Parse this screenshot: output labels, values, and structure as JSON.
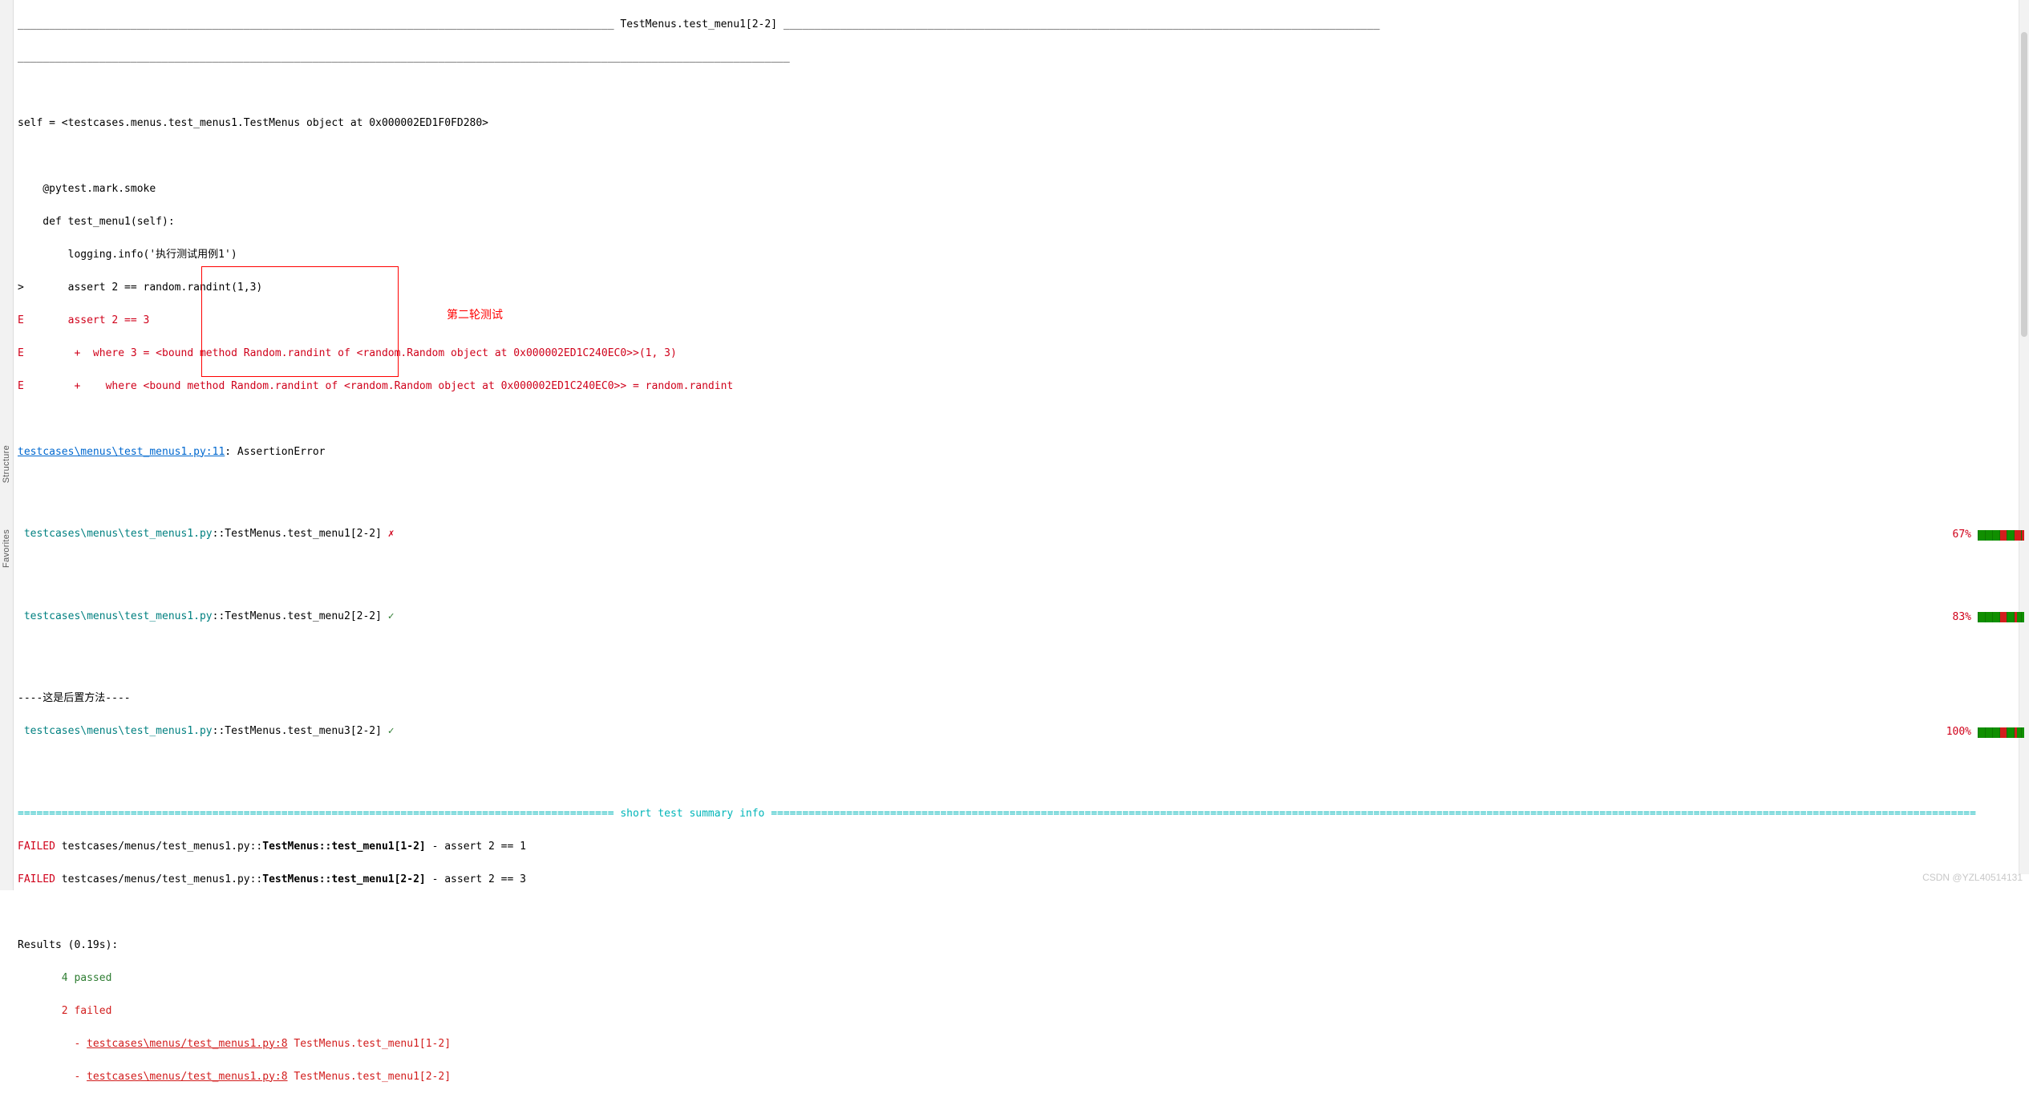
{
  "sidebar": {
    "structure": "Structure",
    "favorites": "Favorites"
  },
  "header": {
    "rule_left": "_______________________________________________________________________________________________",
    "test_label": " TestMenus.test_menu1[2-2] ",
    "rule_right": "_______________________________________________________________________________________________",
    "rule_under": "___________________________________________________________________________________________________________________________"
  },
  "self_line": "self = <testcases.menus.test_menus1.TestMenus object at 0x000002ED1F0FD280>",
  "code": {
    "decorator": "    @pytest.mark.smoke",
    "def": "    def test_menu1(self):",
    "log": "        logging.info('执行测试用例1')",
    "assert": ">       assert 2 == random.randint(1,3)",
    "e1": "E       assert 2 == 3",
    "e2": "E        +  where 3 = <bound method Random.randint of <random.Random object at 0x000002ED1C240EC0>>(1, 3)",
    "e3": "E        +    where <bound method Random.randint of <random.Random object at 0x000002ED1C240EC0>> = random.randint"
  },
  "file_err": {
    "link": "testcases\\menus\\test_menus1.py:11",
    "suffix": ": AssertionError"
  },
  "rows": [
    {
      "path": " testcases\\menus\\test_menus1.py",
      "test": "::TestMenus.test_menu1[2-2] ",
      "mark": "✗",
      "pass": false,
      "pct": "67%",
      "bar": [
        [
          "g",
          0,
          9
        ],
        [
          "g",
          9,
          18
        ],
        [
          "g",
          18,
          27
        ],
        [
          "r",
          27,
          36
        ],
        [
          "g",
          36,
          45
        ],
        [
          "r",
          45,
          58
        ]
      ]
    },
    {
      "path": " testcases\\menus\\test_menus1.py",
      "test": "::TestMenus.test_menu2[2-2] ",
      "mark": "✓",
      "pass": true,
      "pct": "83%",
      "bar": [
        [
          "g",
          0,
          9
        ],
        [
          "g",
          9,
          18
        ],
        [
          "g",
          18,
          27
        ],
        [
          "r",
          27,
          36
        ],
        [
          "g",
          36,
          45
        ],
        [
          "r",
          45,
          49
        ],
        [
          "g",
          49,
          58
        ]
      ]
    },
    {
      "path": " testcases\\menus\\test_menus1.py",
      "test": "::TestMenus.test_menu3[2-2] ",
      "mark": "✓",
      "pass": true,
      "pct": "100%",
      "bar": [
        [
          "g",
          0,
          9
        ],
        [
          "g",
          9,
          18
        ],
        [
          "g",
          18,
          27
        ],
        [
          "r",
          27,
          36
        ],
        [
          "g",
          36,
          45
        ],
        [
          "r",
          45,
          49
        ],
        [
          "g",
          49,
          58
        ]
      ]
    }
  ],
  "teardown": "----这是后置方法----",
  "summary_sep": {
    "left": "=============================================================================================== ",
    "label": "short test summary info",
    "right": " ================================================================================================================================================================================================"
  },
  "failures": [
    {
      "prefix": "FAILED ",
      "path": "testcases/menus/test_menus1.py::",
      "bold": "TestMenus::test_menu1[1-2]",
      "suffix": " - assert 2 == 1"
    },
    {
      "prefix": "FAILED ",
      "path": "testcases/menus/test_menus1.py::",
      "bold": "TestMenus::test_menu1[2-2]",
      "suffix": " - assert 2 == 3"
    }
  ],
  "results": {
    "header": "Results (0.19s):",
    "passed": "       4 passed",
    "failed": "       2 failed",
    "line1_prefix": "         - ",
    "line1_link": "testcases\\menus/test_menus1.py:8",
    "line1_suffix": " TestMenus.test_menu1[1-2]",
    "line2_prefix": "         - ",
    "line2_link": "testcases\\menus/test_menus1.py:8",
    "line2_suffix": " TestMenus.test_menu1[2-2]"
  },
  "annotation": "第二轮测试",
  "watermark": "CSDN @YZL40514131"
}
